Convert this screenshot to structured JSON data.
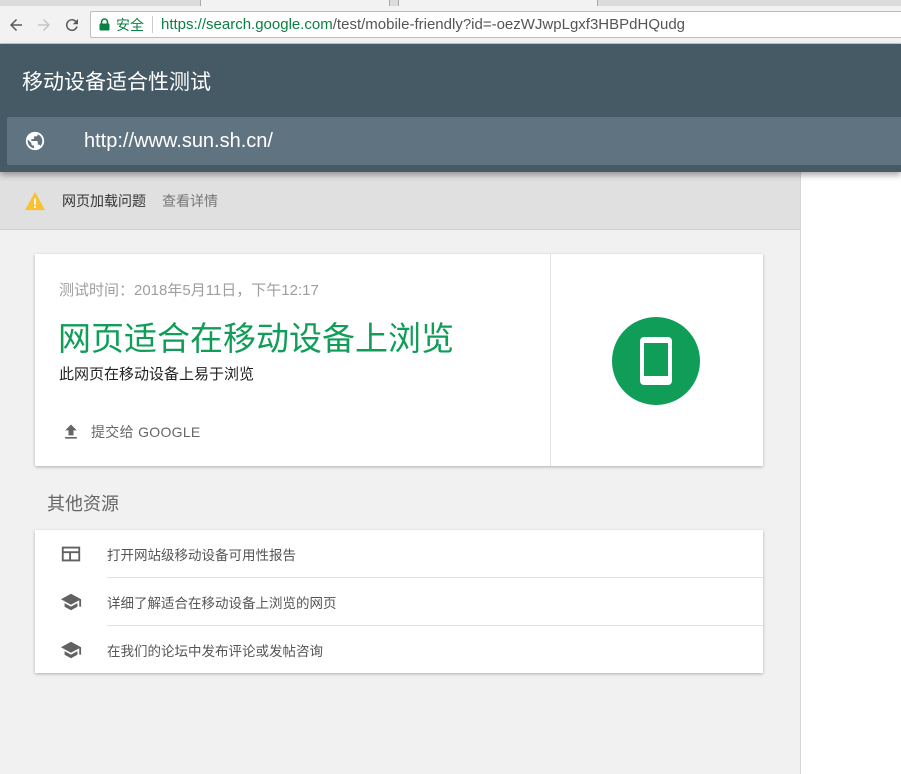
{
  "browser": {
    "secure_label": "安全",
    "url_scheme_host": "https://search.google.com",
    "url_rest": "/test/mobile-friendly?id=-oezWJwpLgxf3HBPdHQudg"
  },
  "app": {
    "title": "移动设备适合性测试",
    "tested_url": "http://www.sun.sh.cn/"
  },
  "warning": {
    "text": "网页加载问题",
    "link": "查看详情"
  },
  "result": {
    "time": "测试时间：2018年5月11日，下午12:17",
    "verdict": "网页适合在移动设备上浏览",
    "description": "此网页在移动设备上易于浏览",
    "submit_label": "提交给 GOOGLE"
  },
  "resources": {
    "title": "其他资源",
    "items": [
      {
        "label": "打开网站级移动设备可用性报告",
        "icon": "dashboard-icon"
      },
      {
        "label": "详细了解适合在移动设备上浏览的网页",
        "icon": "school-icon"
      },
      {
        "label": "在我们的论坛中发布评论或发帖咨询",
        "icon": "school-icon"
      }
    ]
  },
  "colors": {
    "header": "#455a64",
    "success": "#0f9d58",
    "warning": "#fbc02d"
  }
}
